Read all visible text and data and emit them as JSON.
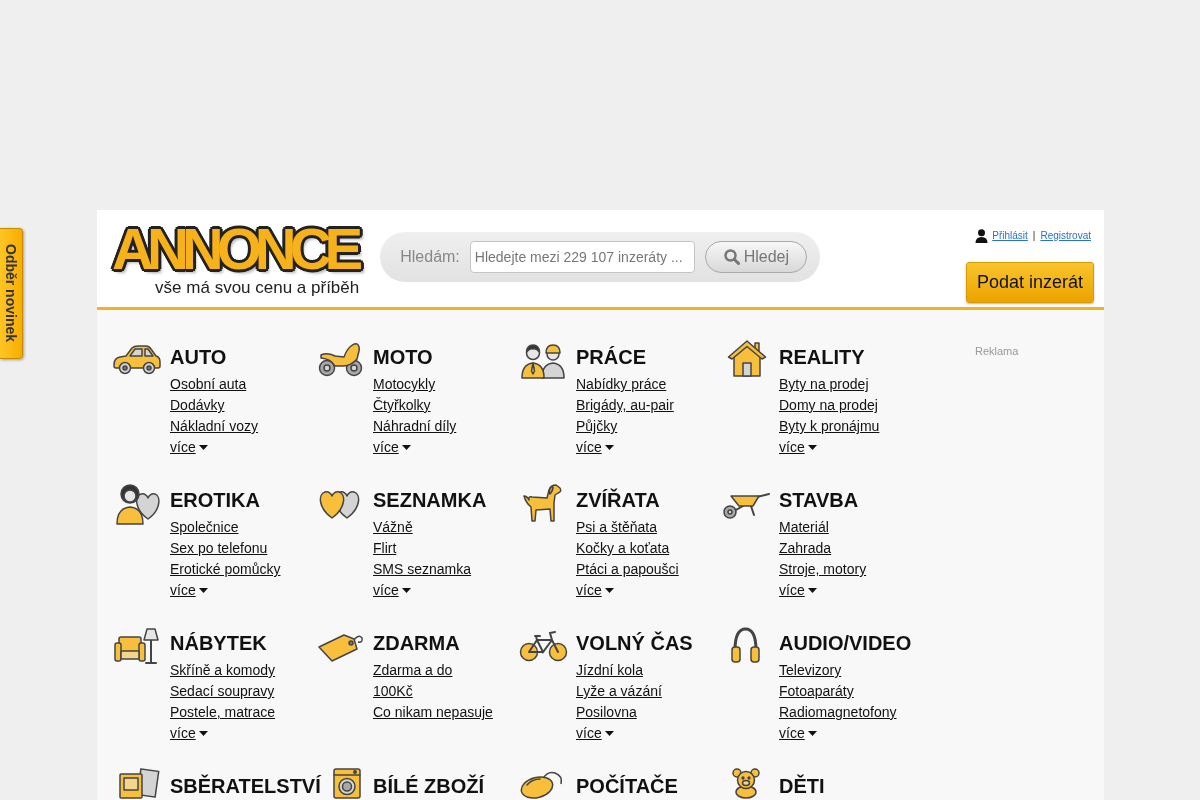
{
  "side_tab": {
    "label": "Odběr novinek"
  },
  "header": {
    "logo": {
      "name": "ANNONCE",
      "tagline": "vše má svou cenu a příběh"
    },
    "search": {
      "label": "Hledám:",
      "placeholder": "Hledejte mezi 229 107 inzeráty ...",
      "button": "Hledej"
    },
    "account": {
      "login": "Přihlásit",
      "separator": "|",
      "register": "Registrovat"
    },
    "post_button": "Podat inzerát"
  },
  "categories": [
    {
      "title": "AUTO",
      "links": [
        "Osobní auta",
        "Dodávky",
        "Nákladní vozy"
      ],
      "more": "více"
    },
    {
      "title": "MOTO",
      "links": [
        "Motocykly",
        "Čtyřkolky",
        "Náhradní díly"
      ],
      "more": "více"
    },
    {
      "title": "PRÁCE",
      "links": [
        "Nabídky práce",
        "Brigády, au-pair",
        "Půjčky"
      ],
      "more": "více"
    },
    {
      "title": "REALITY",
      "links": [
        "Byty na prodej",
        "Domy na prodej",
        "Byty k pronájmu"
      ],
      "more": "více"
    },
    {
      "title": "EROTIKA",
      "links": [
        "Společnice",
        "Sex po telefonu",
        "Erotické pomůcky"
      ],
      "more": "více"
    },
    {
      "title": "SEZNAMKA",
      "links": [
        "Vážně",
        "Flirt",
        "SMS seznamka"
      ],
      "more": "více"
    },
    {
      "title": "ZVÍŘATA",
      "links": [
        "Psi a štěňata",
        "Kočky a koťata",
        "Ptáci a papoušci"
      ],
      "more": "více"
    },
    {
      "title": "STAVBA",
      "links": [
        "Materiál",
        "Zahrada",
        "Stroje, motory"
      ],
      "more": "více"
    },
    {
      "title": "NÁBYTEK",
      "links": [
        "Skříně a komody",
        "Sedací soupravy",
        "Postele, matrace"
      ],
      "more": "více"
    },
    {
      "title": "ZDARMA",
      "links": [
        "Zdarma a do 100Kč",
        "Co nikam nepasuje"
      ]
    },
    {
      "title": "VOLNÝ ČAS",
      "links": [
        "Jízdní kola",
        "Lyže a vázání",
        "Posilovna"
      ],
      "more": "více"
    },
    {
      "title": "AUDIO/VIDEO",
      "links": [
        "Televizory",
        "Fotoaparáty",
        "Radiomagnetofony"
      ],
      "more": "více"
    },
    {
      "title": "SBĚRATELSTVÍ"
    },
    {
      "title": "BÍLÉ ZBOŽÍ"
    },
    {
      "title": "POČÍTAČE"
    },
    {
      "title": "DĚTI"
    }
  ],
  "ad": {
    "label": "Reklama"
  }
}
